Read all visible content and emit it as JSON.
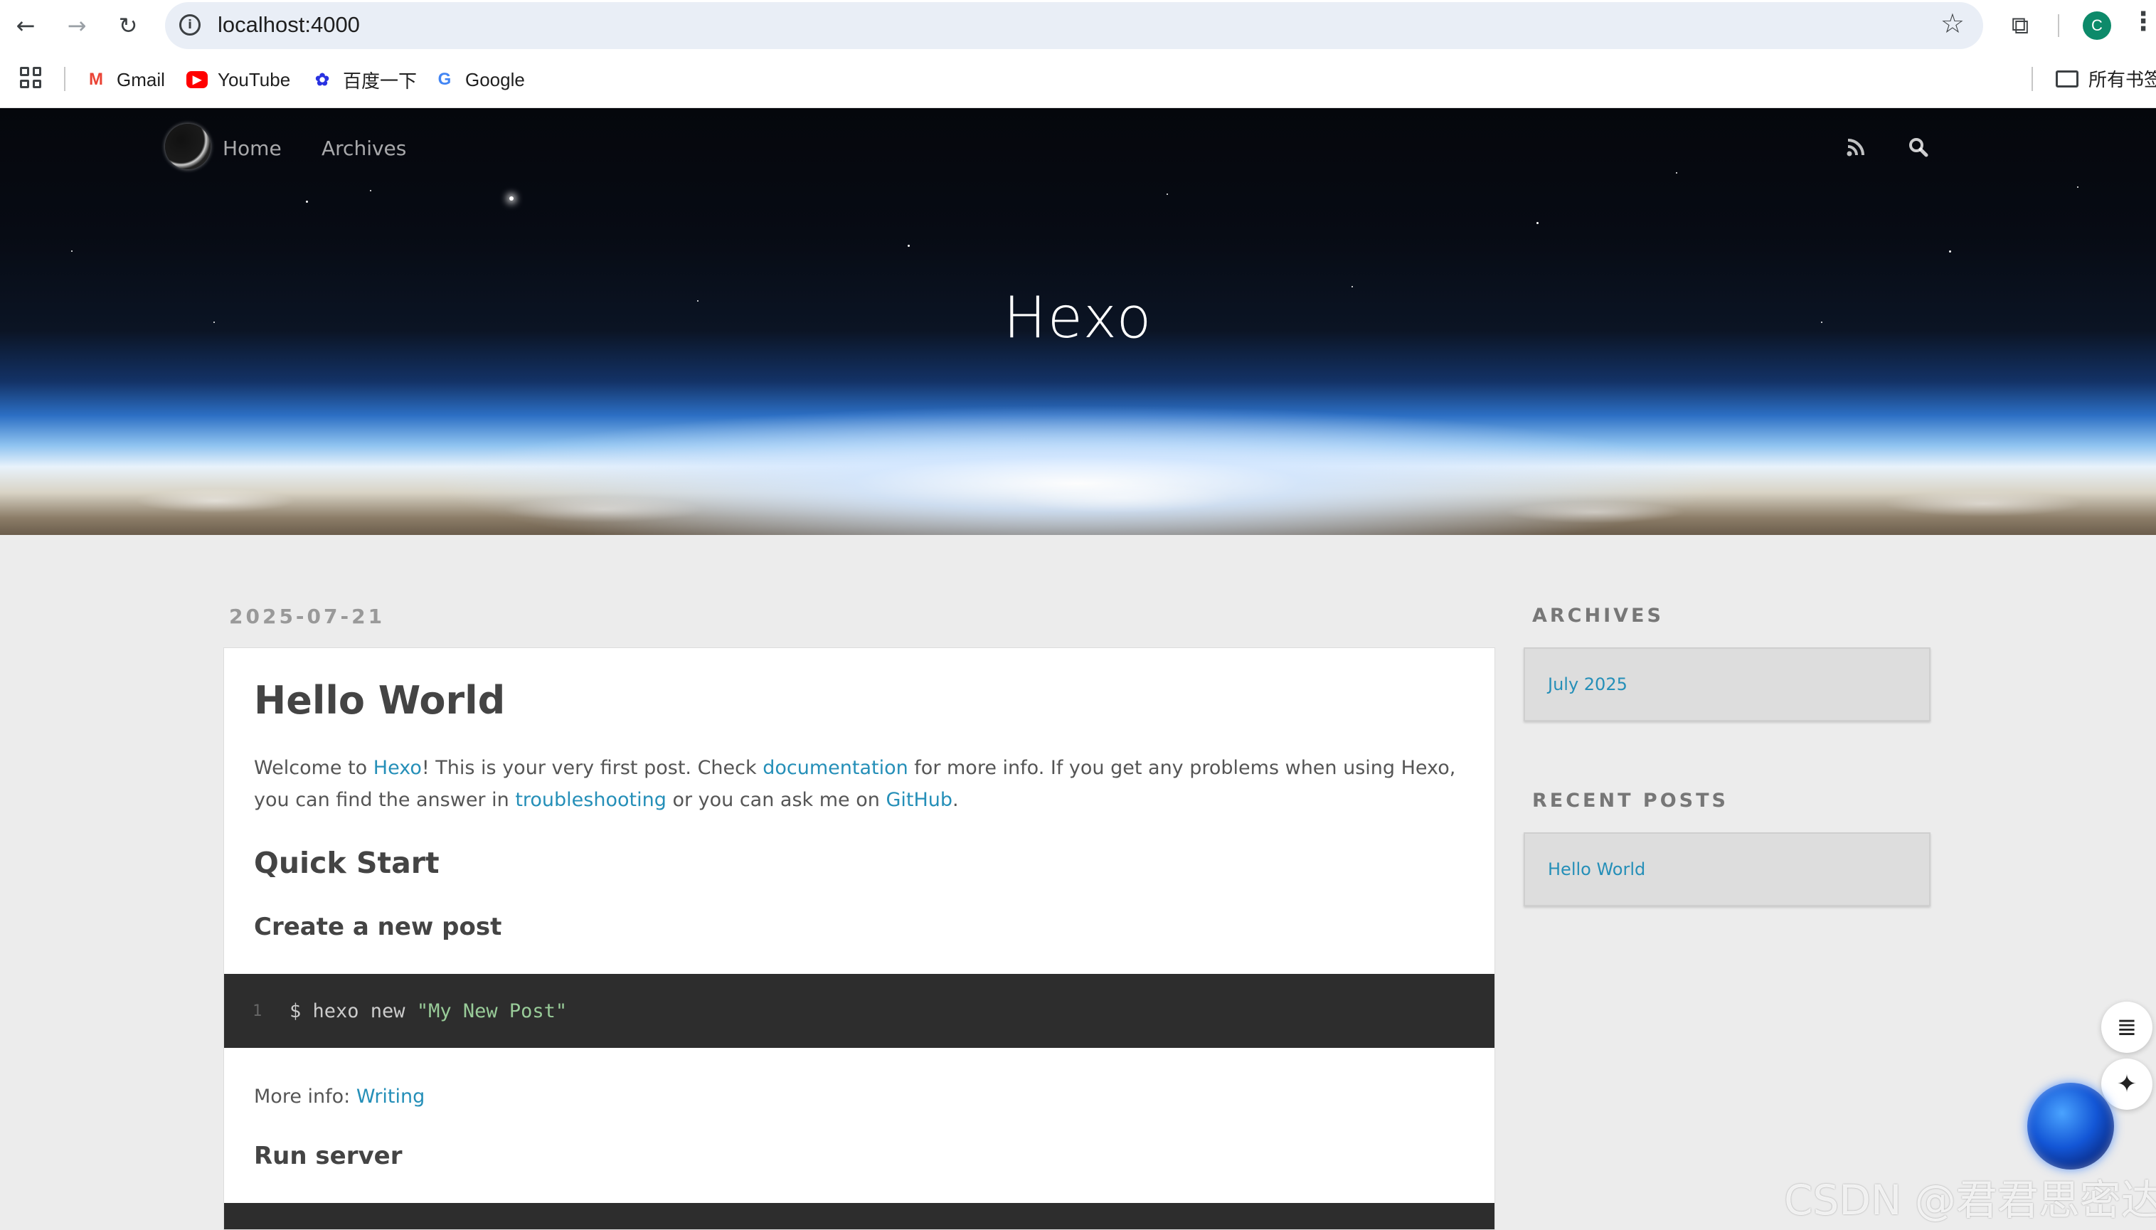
{
  "browser": {
    "url": "localhost:4000",
    "bookmarks": [
      {
        "label": "Gmail",
        "icon": "gmail-icon",
        "color": "#ea4335"
      },
      {
        "label": "YouTube",
        "icon": "youtube-icon",
        "color": "#ff0000"
      },
      {
        "label": "百度一下",
        "icon": "baidu-icon",
        "color": "#2932e1"
      },
      {
        "label": "Google",
        "icon": "google-icon",
        "color": "#4285f4"
      }
    ],
    "bookmarks_folder": "所有书签",
    "profile_initial": "C"
  },
  "site": {
    "title": "Hexo",
    "nav": [
      "Home",
      "Archives"
    ]
  },
  "post": {
    "date": "2025-07-21",
    "title": "Hello World",
    "intro": {
      "t1": "Welcome to ",
      "link1": "Hexo",
      "t2": "! This is your very first post. Check ",
      "link2": "documentation",
      "t3": " for more info. If you get any problems when using Hexo, you can find the answer in ",
      "link3": "troubleshooting",
      "t4": " or you can ask me on ",
      "link4": "GitHub",
      "t5": "."
    },
    "h_quick_start": "Quick Start",
    "h_create_post": "Create a new post",
    "code1": {
      "line_no": "1",
      "cmd": "$ hexo new ",
      "arg": "\"My New Post\""
    },
    "more_info_label": "More info: ",
    "more_info_link": "Writing",
    "h_run_server": "Run server"
  },
  "sidebar": {
    "archives_title": "ARCHIVES",
    "archives_item": "July 2025",
    "recent_title": "RECENT POSTS",
    "recent_item": "Hello World"
  },
  "watermark": "CSDN @君君思密达",
  "colors": {
    "link": "#258fb8",
    "code_bg": "#2d2d2d",
    "page_bg": "#ececec"
  }
}
